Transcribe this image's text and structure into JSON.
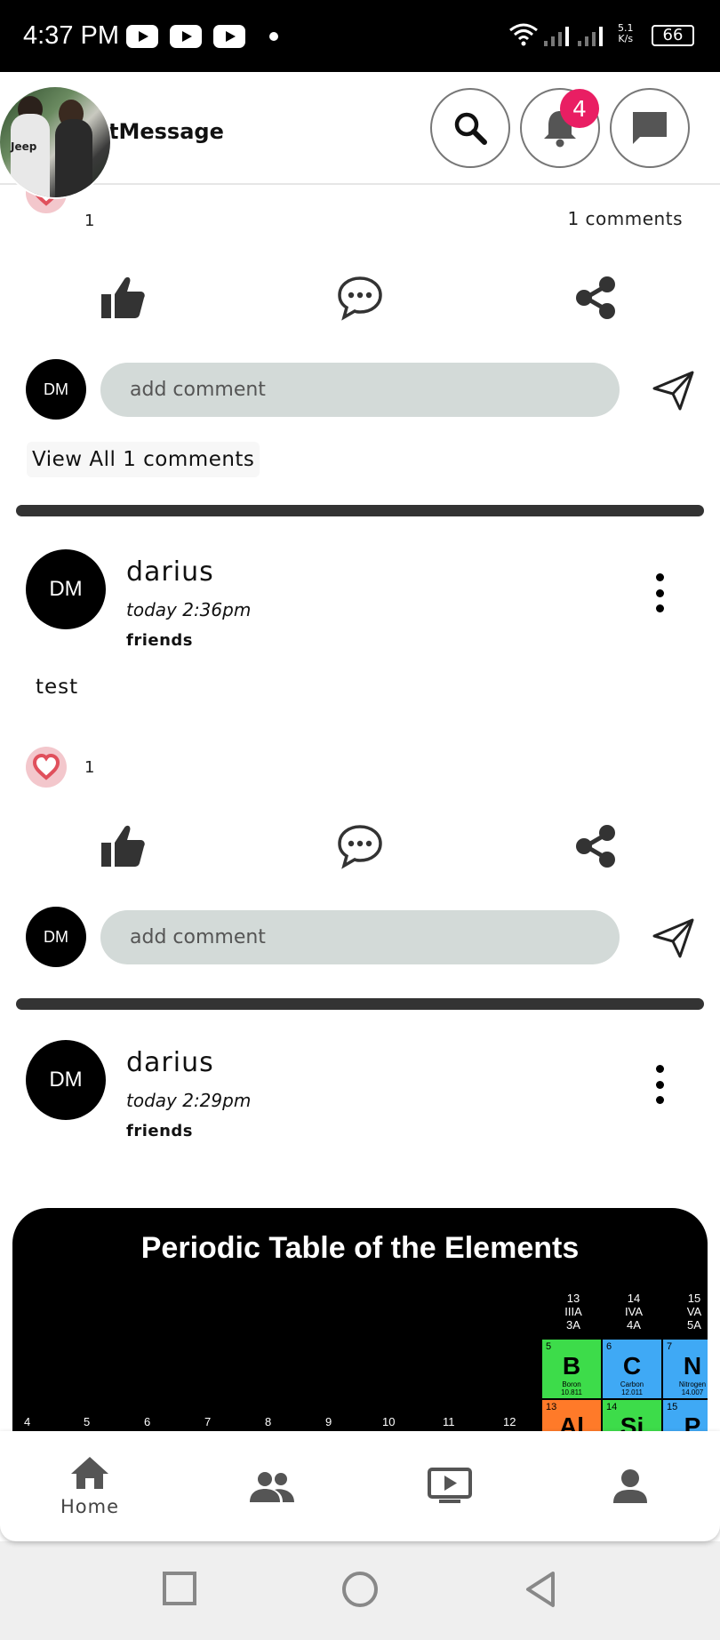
{
  "status_bar": {
    "time": "4:37 PM",
    "speed_value": "5.1",
    "speed_unit": "K/s",
    "battery": "66"
  },
  "app_bar": {
    "title": "tMessage",
    "notification_count": "4"
  },
  "posts": [
    {
      "likes": "1",
      "comments_count": "1 comments",
      "comment_placeholder": "add comment",
      "view_all": "View All 1 comments"
    },
    {
      "avatar_initials": "DM",
      "author": "darius",
      "time": "today 2:36pm",
      "audience": "friends",
      "text": "test",
      "likes": "1",
      "comment_placeholder": "add comment"
    },
    {
      "avatar_initials": "DM",
      "author": "darius",
      "time": "today 2:29pm",
      "audience": "friends",
      "image": {
        "title": "Periodic Table of the Elements",
        "groups": [
          {
            "num": "13",
            "roman": "IIIA",
            "cas": "3A"
          },
          {
            "num": "14",
            "roman": "IVA",
            "cas": "4A"
          },
          {
            "num": "15",
            "roman": "VA",
            "cas": "5A"
          }
        ],
        "elements": [
          {
            "number": "5",
            "symbol": "B",
            "name": "Boron",
            "mass": "10.811",
            "color": "#3ddc4a"
          },
          {
            "number": "6",
            "symbol": "C",
            "name": "Carbon",
            "mass": "12.011",
            "color": "#3fa9f5"
          },
          {
            "number": "7",
            "symbol": "N",
            "name": "Nitrogen",
            "mass": "14.007",
            "color": "#3fa9f5"
          },
          {
            "number": "13",
            "symbol": "Al",
            "name": "",
            "mass": "",
            "color": "#ff7a29"
          },
          {
            "number": "14",
            "symbol": "Si",
            "name": "",
            "mass": "",
            "color": "#3ddc4a"
          },
          {
            "number": "15",
            "symbol": "P",
            "name": "",
            "mass": "",
            "color": "#3fa9f5"
          }
        ],
        "column_numbers": [
          "4",
          "5",
          "6",
          "7",
          "8",
          "9",
          "10",
          "11",
          "12"
        ]
      }
    }
  ],
  "bottom_nav": {
    "items": [
      {
        "label": "Home",
        "icon": "home-icon",
        "active": true
      },
      {
        "label": "",
        "icon": "friends-icon"
      },
      {
        "label": "",
        "icon": "video-icon"
      },
      {
        "label": "",
        "icon": "profile-icon"
      }
    ]
  },
  "colors": {
    "badge": "#e91e63",
    "heart": "#e0505c",
    "input_bg": "#d3dad8",
    "divider": "#333333",
    "icon": "#555555"
  }
}
